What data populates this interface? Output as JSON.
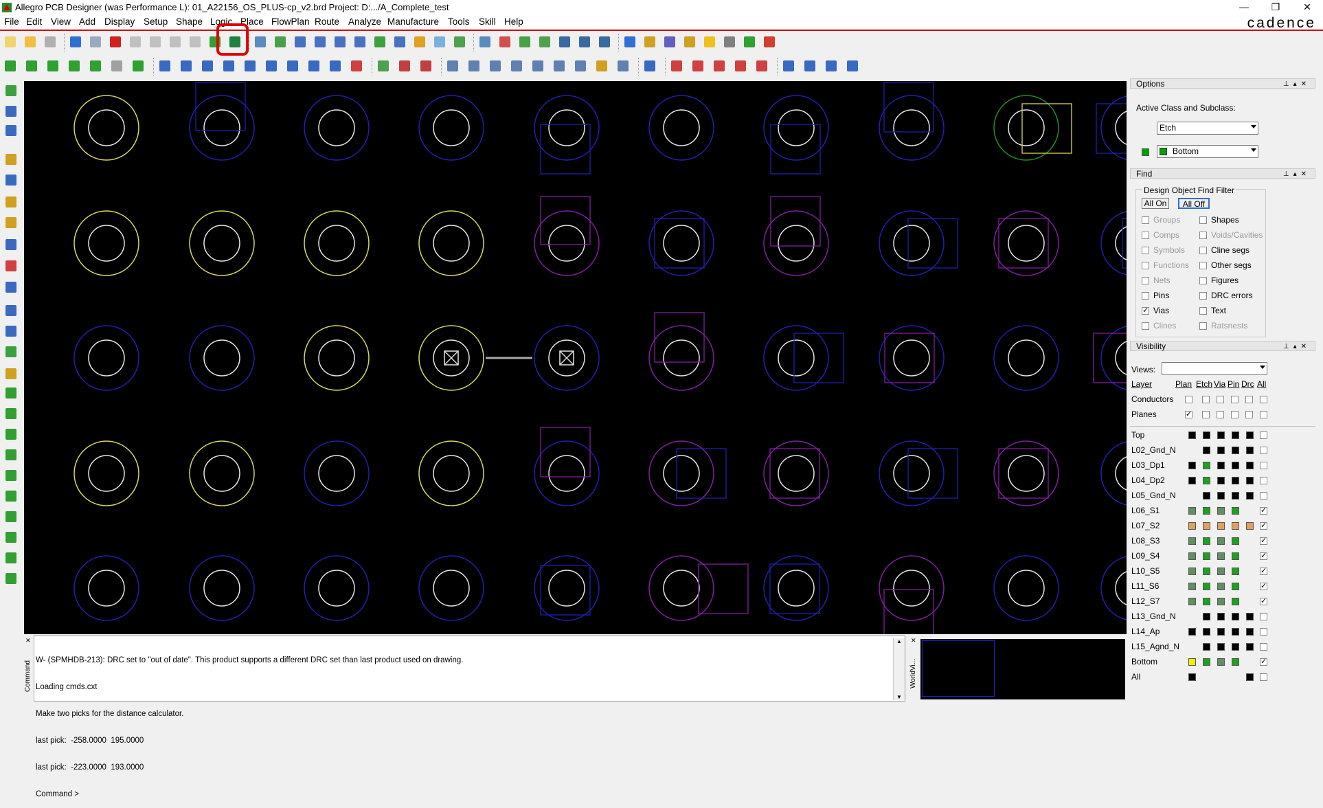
{
  "window": {
    "title": "Allegro PCB Designer (was Performance L): 01_A22156_OS_PLUS-cp_v2.brd  Project: D:.../A_Complete_test",
    "controls": [
      "—",
      "❐",
      "✕"
    ]
  },
  "brand": "cadence",
  "menu": [
    "File",
    "Edit",
    "View",
    "Add",
    "Display",
    "Setup",
    "Shape",
    "Logic",
    "Place",
    "FlowPlan",
    "Route",
    "Analyze",
    "Manufacture",
    "Tools",
    "Skill",
    "Help"
  ],
  "colors": {
    "accent_red": "#d40000",
    "canvas_bg": "#000000",
    "via_yellow": "#d8d85a",
    "via_blue": "#2020b0",
    "via_purple": "#8020a0",
    "via_green": "#209020",
    "via_white": "#e8e8e8"
  },
  "console": {
    "side_label": "Command",
    "lines": [
      "W- (SPMHDB-213): DRC set to \"out of date\". This product supports a different DRC set than last product used on drawing.",
      "Loading cmds.cxt",
      "Make two picks for the distance calculator.",
      "last pick:  -258.0000  195.0000",
      "last pick:  -223.0000  193.0000",
      "Command >"
    ]
  },
  "worldview": {
    "side_label": "WorldVi..."
  },
  "options": {
    "header": "Options",
    "active_label": "Active Class and Subclass:",
    "class_value": "Etch",
    "subclass_value": "Bottom",
    "subclass_color": "#00a000"
  },
  "find": {
    "header": "Find",
    "group_title": "Design Object Find Filter",
    "all_on": "All On",
    "all_off": "All Off",
    "left": [
      {
        "label": "Groups",
        "checked": false,
        "enabled": false
      },
      {
        "label": "Comps",
        "checked": false,
        "enabled": false
      },
      {
        "label": "Symbols",
        "checked": false,
        "enabled": false
      },
      {
        "label": "Functions",
        "checked": false,
        "enabled": false
      },
      {
        "label": "Nets",
        "checked": false,
        "enabled": false
      },
      {
        "label": "Pins",
        "checked": false,
        "enabled": true
      },
      {
        "label": "Vias",
        "checked": true,
        "enabled": true
      },
      {
        "label": "Clines",
        "checked": false,
        "enabled": false
      }
    ],
    "right": [
      {
        "label": "Shapes",
        "checked": false,
        "enabled": true
      },
      {
        "label": "Voids/Cavities",
        "checked": false,
        "enabled": false
      },
      {
        "label": "Cline segs",
        "checked": false,
        "enabled": true
      },
      {
        "label": "Other segs",
        "checked": false,
        "enabled": true
      },
      {
        "label": "Figures",
        "checked": false,
        "enabled": true
      },
      {
        "label": "DRC errors",
        "checked": false,
        "enabled": true
      },
      {
        "label": "Text",
        "checked": false,
        "enabled": true
      },
      {
        "label": "Ratsnests",
        "checked": false,
        "enabled": false
      }
    ]
  },
  "visibility": {
    "header": "Visibility",
    "views_label": "Views:",
    "views_value": "",
    "col_headers": [
      "Layer",
      "Plan",
      "Etch",
      "Via",
      "Pin",
      "Drc",
      "All"
    ],
    "conductors_label": "Conductors",
    "planes_label": "Planes",
    "layers": [
      {
        "name": "Top",
        "chips": [
          "#000000",
          "#000000",
          "#000000",
          "#000000",
          "#000000"
        ],
        "all": false
      },
      {
        "name": "L02_Gnd_N",
        "chips": [
          "",
          "#000000",
          "#000000",
          "#000000",
          "#000000"
        ],
        "all": false
      },
      {
        "name": "L03_Dp1",
        "chips": [
          "#000000",
          "#20a020",
          "#000000",
          "#000000",
          "#000000"
        ],
        "all": false
      },
      {
        "name": "L04_Dp2",
        "chips": [
          "#000000",
          "#20a020",
          "#000000",
          "#000000",
          "#000000"
        ],
        "all": false
      },
      {
        "name": "L05_Gnd_N",
        "chips": [
          "",
          "#000000",
          "#000000",
          "#000000",
          "#000000"
        ],
        "all": false
      },
      {
        "name": "L06_S1",
        "chips": [
          "#609060",
          "#20a020",
          "#609060",
          "#20a020",
          ""
        ],
        "all": true
      },
      {
        "name": "L07_S2",
        "chips": [
          "#e0a060",
          "#e0a060",
          "#e0a060",
          "#e0a060",
          "#e0a060"
        ],
        "all": true
      },
      {
        "name": "L08_S3",
        "chips": [
          "#609060",
          "#20a020",
          "#609060",
          "#20a020",
          ""
        ],
        "all": true
      },
      {
        "name": "L09_S4",
        "chips": [
          "#609060",
          "#20a020",
          "#609060",
          "#20a020",
          ""
        ],
        "all": true
      },
      {
        "name": "L10_S5",
        "chips": [
          "#609060",
          "#20a020",
          "#609060",
          "#20a020",
          ""
        ],
        "all": true
      },
      {
        "name": "L11_S6",
        "chips": [
          "#609060",
          "#20a020",
          "#609060",
          "#20a020",
          ""
        ],
        "all": true
      },
      {
        "name": "L12_S7",
        "chips": [
          "#609060",
          "#20a020",
          "#609060",
          "#20a020",
          ""
        ],
        "all": true
      },
      {
        "name": "L13_Gnd_N",
        "chips": [
          "",
          "#000000",
          "#000000",
          "#000000",
          "#000000"
        ],
        "all": false
      },
      {
        "name": "L14_Ap",
        "chips": [
          "#000000",
          "#000000",
          "#000000",
          "#000000",
          "#000000"
        ],
        "all": false
      },
      {
        "name": "L15_Agnd_N",
        "chips": [
          "",
          "#000000",
          "#000000",
          "#000000",
          "#000000"
        ],
        "all": false
      },
      {
        "name": "Bottom",
        "chips": [
          "#f0f000",
          "#20a020",
          "#609060",
          "#20a020",
          ""
        ],
        "all": true
      },
      {
        "name": "All",
        "chips": [
          "#000000",
          "",
          "",
          "",
          "#000000"
        ],
        "all": false
      }
    ]
  }
}
